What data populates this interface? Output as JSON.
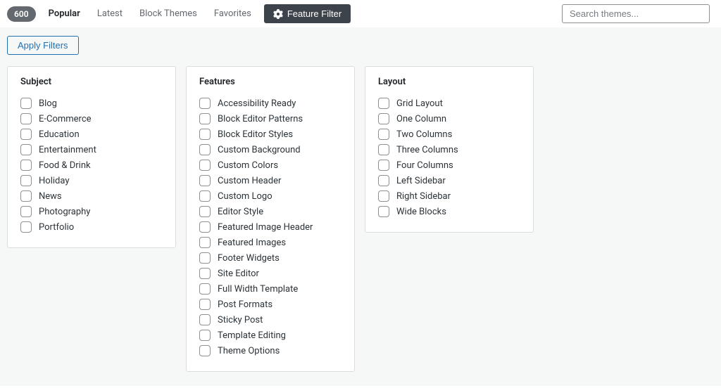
{
  "header": {
    "count": "600",
    "tabs": {
      "popular": "Popular",
      "latest": "Latest",
      "blockThemes": "Block Themes",
      "favorites": "Favorites"
    },
    "featureFilterLabel": "Feature Filter",
    "searchPlaceholder": "Search themes..."
  },
  "applyFiltersLabel": "Apply Filters",
  "columns": {
    "subject": {
      "title": "Subject",
      "items": [
        "Blog",
        "E-Commerce",
        "Education",
        "Entertainment",
        "Food & Drink",
        "Holiday",
        "News",
        "Photography",
        "Portfolio"
      ]
    },
    "features": {
      "title": "Features",
      "items": [
        "Accessibility Ready",
        "Block Editor Patterns",
        "Block Editor Styles",
        "Custom Background",
        "Custom Colors",
        "Custom Header",
        "Custom Logo",
        "Editor Style",
        "Featured Image Header",
        "Featured Images",
        "Footer Widgets",
        "Site Editor",
        "Full Width Template",
        "Post Formats",
        "Sticky Post",
        "Template Editing",
        "Theme Options"
      ]
    },
    "layout": {
      "title": "Layout",
      "items": [
        "Grid Layout",
        "One Column",
        "Two Columns",
        "Three Columns",
        "Four Columns",
        "Left Sidebar",
        "Right Sidebar",
        "Wide Blocks"
      ]
    }
  }
}
